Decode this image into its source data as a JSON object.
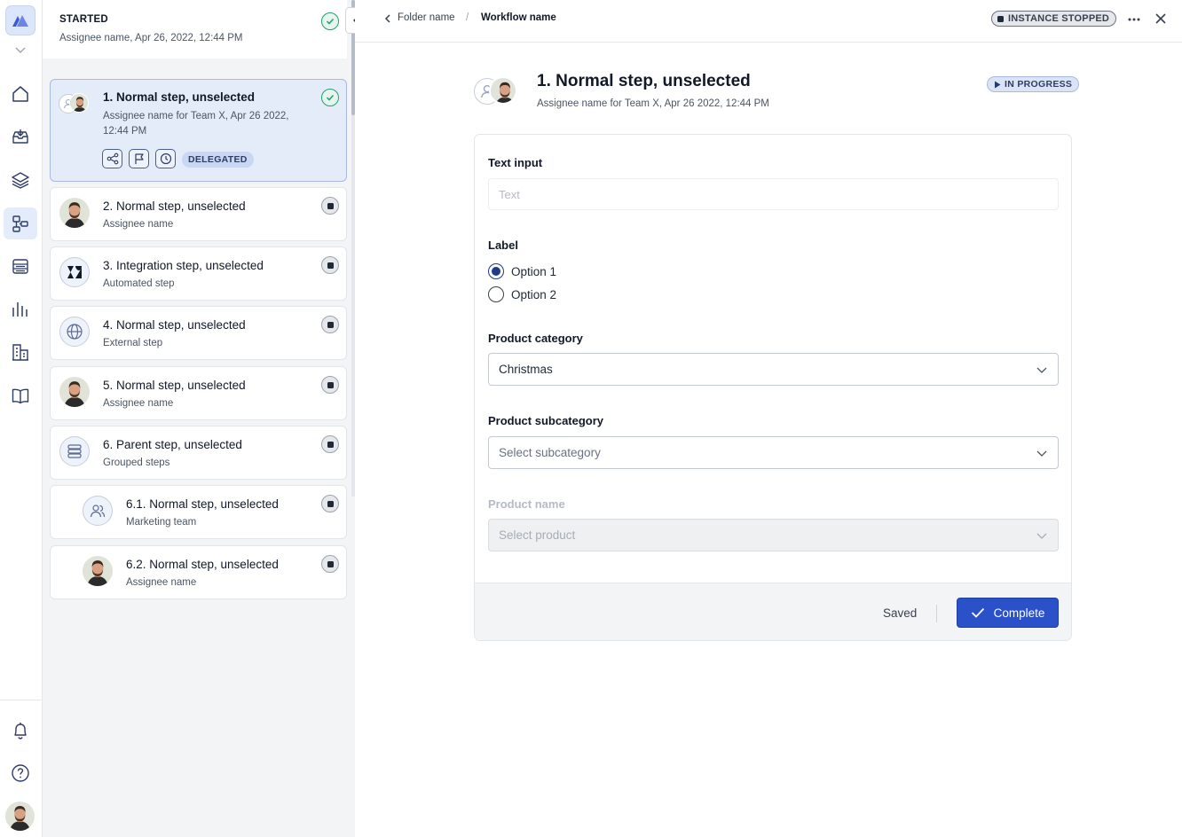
{
  "rail": {
    "items": [
      "home-icon",
      "inbox-icon",
      "layers-icon",
      "workflow-icon",
      "list-icon",
      "analytics-icon",
      "building-icon",
      "book-icon"
    ],
    "active_index": 3,
    "bottom": [
      "bell-icon",
      "help-icon"
    ]
  },
  "started": {
    "title": "STARTED",
    "subtitle": "Assignee name, Apr 26, 2022, 12:44 PM"
  },
  "steps": [
    {
      "title": "1. Normal step, unselected",
      "sub": "Assignee name for Team X, Apr 26 2022, 12:44 PM",
      "status": "done",
      "badge": "DELEGATED"
    },
    {
      "title": "2. Normal step, unselected",
      "sub": "Assignee name",
      "status": "stopped"
    },
    {
      "title": "3. Integration step, unselected",
      "sub": "Automated step",
      "status": "stopped"
    },
    {
      "title": "4. Normal step, unselected",
      "sub": "External step",
      "status": "stopped"
    },
    {
      "title": "5. Normal step, unselected",
      "sub": "Assignee name",
      "status": "stopped"
    },
    {
      "title": "6. Parent step, unselected",
      "sub": "Grouped steps",
      "status": "stopped"
    },
    {
      "title": "6.1. Normal step, unselected",
      "sub": "Marketing team",
      "status": "stopped"
    },
    {
      "title": "6.2. Normal step, unselected",
      "sub": "Assignee name",
      "status": "stopped"
    }
  ],
  "breadcrumb": {
    "folder": "Folder name",
    "separator": "/",
    "workflow": "Workflow name"
  },
  "instance_status": "INSTANCE STOPPED",
  "step_header": {
    "title": "1. Normal step, unselected",
    "subtitle": "Assignee name for Team X, Apr 26 2022, 12:44 PM",
    "status": "IN PROGRESS"
  },
  "form": {
    "text_input": {
      "label": "Text input",
      "placeholder": "Text"
    },
    "radio": {
      "label": "Label",
      "options": [
        "Option 1",
        "Option 2"
      ],
      "selected": "Option 1"
    },
    "product_category": {
      "label": "Product category",
      "value": "Christmas"
    },
    "product_subcategory": {
      "label": "Product subcategory",
      "placeholder": "Select subcategory"
    },
    "product_name": {
      "label": "Product name",
      "placeholder": "Select product",
      "disabled": true
    },
    "saved": "Saved",
    "complete": "Complete"
  },
  "colors": {
    "accent": "#2a51c9",
    "selected_card": "#e5ecf9",
    "success": "#22a06b"
  }
}
